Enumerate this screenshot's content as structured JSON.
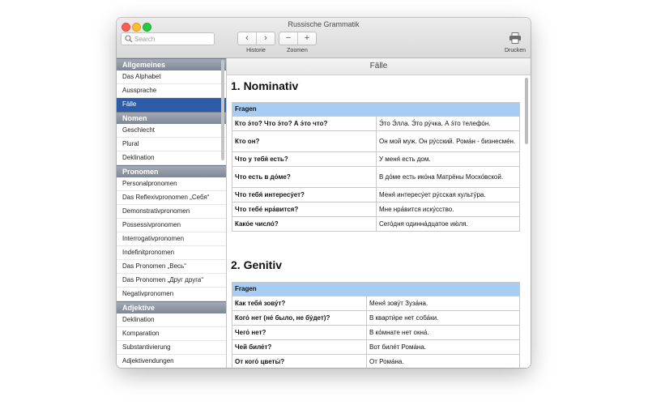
{
  "window": {
    "title": "Russische Grammatik"
  },
  "toolbar": {
    "search_placeholder": "Search",
    "history_label": "Historie",
    "history_back": "‹",
    "history_forward": "›",
    "zoom_label": "Zoomen",
    "zoom_out": "−",
    "zoom_in": "+",
    "print_label": "Drucken"
  },
  "sidebar": {
    "sections": [
      {
        "header": "Allgemeines",
        "items": [
          "Das Alphabet",
          "Aussprache",
          "Fälle"
        ]
      },
      {
        "header": "Nomen",
        "items": [
          "Geschlecht",
          "Plural",
          "Deklination"
        ]
      },
      {
        "header": "Pronomen",
        "items": [
          "Personalpronomen",
          "Das Reflexivpronomen „Себя“",
          "Demonstrativpronomen",
          "Possessivpronomen",
          "Interrogativpronomen",
          "Indefinitpronomen",
          "Das Pronomen „Весь“",
          "Das Pronomen „Друг друга“",
          "Negativpronomen"
        ]
      },
      {
        "header": "Adjektive",
        "items": [
          "Deklination",
          "Komparation",
          "Substantivierung",
          "Adjektivendungen"
        ]
      }
    ],
    "active_item": "Fälle"
  },
  "content": {
    "header": "Fälle",
    "sections": [
      {
        "title": "1. Nominativ",
        "table_header": "Fragen",
        "rows": [
          [
            "Кто э́то? Что э́то? А э́то что?",
            "Э́то Э́лла. Э́то ру́чка. А э́то телефо́н."
          ],
          [
            "Кто он?",
            "Он мой муж. Он ру́сский. Рома́н - бизнесме́н."
          ],
          [
            "Что у тебя́ есть?",
            "У меня́ есть дом."
          ],
          [
            "Что есть в до́ме?",
            "В до́ме есть ико́на Матрёны Моско́вской."
          ],
          [
            "Что тебя́ интересу́ет?",
            "Меня́ интересу́ет ру́сская культу́ра."
          ],
          [
            "Что тебе́ нра́вится?",
            "Мне нра́вится иску́сство."
          ],
          [
            "Како́е число́?",
            "Сего́дня одинна́дцатое ию́ля."
          ]
        ]
      },
      {
        "title": "2. Genitiv",
        "table_header": "Fragen",
        "rows": [
          [
            "Как тебя́ зову́т?",
            "Меня́ зову́т Зуза́на."
          ],
          [
            "Кого́ нет (не́ было, не бу́дет)?",
            "В кварти́ре нет соба́ки."
          ],
          [
            "Чего́ нет?",
            "В ко́мнате нет окна́."
          ],
          [
            "Чей биле́т?",
            "Вот биле́т Рома́на."
          ],
          [
            "От кого́ цветы́?",
            "От Рома́на."
          ]
        ]
      }
    ]
  }
}
